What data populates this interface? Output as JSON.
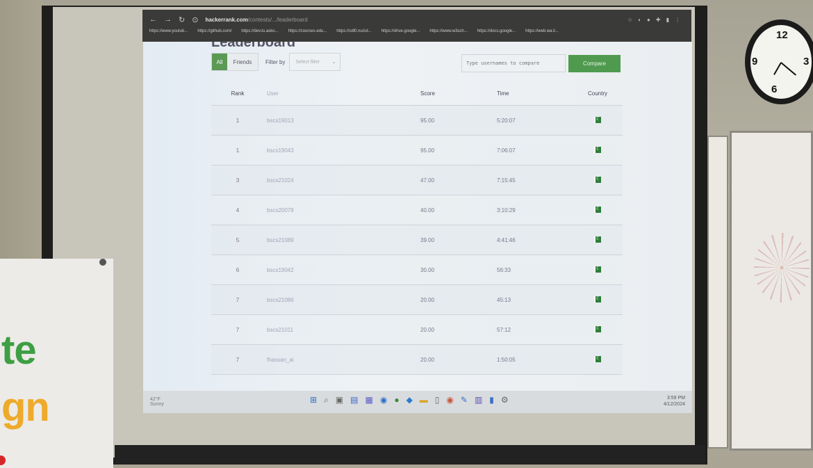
{
  "browser": {
    "url_host": "hackerrank.com",
    "url_path": "/contests/.../leaderboard",
    "bookmarks": [
      "https://www.youtub...",
      "https://github.com/",
      "https://dev.to.asko...",
      "https://courses.edu...",
      "https://cdl0.nu/cd...",
      "https://drive.google...",
      "https://www.w3sch...",
      "https://docs.google...",
      "https://web.wa.li..."
    ]
  },
  "page": {
    "title": "Leaderboard",
    "tab_all": "All",
    "tab_friends": "Friends",
    "filter_label": "Filter by",
    "select_placeholder": "Select filter",
    "compare_placeholder": "Type usernames to compare",
    "compare_button": "Compare"
  },
  "table": {
    "headers": [
      "Rank",
      "User",
      "Score",
      "Time",
      "Country"
    ],
    "rows": [
      {
        "rank": "1",
        "user": "bscs19013",
        "score": "95.00",
        "time": "5:20:07"
      },
      {
        "rank": "1",
        "user": "bscs19043",
        "score": "95.00",
        "time": "7:06:07"
      },
      {
        "rank": "3",
        "user": "bscs21024",
        "score": "47.00",
        "time": "7:15:45"
      },
      {
        "rank": "4",
        "user": "bscs20078",
        "score": "40.00",
        "time": "3:10:29"
      },
      {
        "rank": "5",
        "user": "bscs21089",
        "score": "39.00",
        "time": "4:41:46"
      },
      {
        "rank": "6",
        "user": "bscs19042",
        "score": "30.00",
        "time": "56:33"
      },
      {
        "rank": "7",
        "user": "bscs21086",
        "score": "20.00",
        "time": "45:13"
      },
      {
        "rank": "7",
        "user": "bscs21011",
        "score": "20.00",
        "time": "57:12"
      },
      {
        "rank": "7",
        "user": "fhassan_ai",
        "score": "20.00",
        "time": "1:50:05"
      }
    ]
  },
  "taskbar": {
    "weather": "42°F",
    "weather_sub": "Sunny",
    "time": "3:59 PM",
    "date": "4/12/2024"
  },
  "banner": {
    "line1": "te",
    "line2": "gn"
  }
}
